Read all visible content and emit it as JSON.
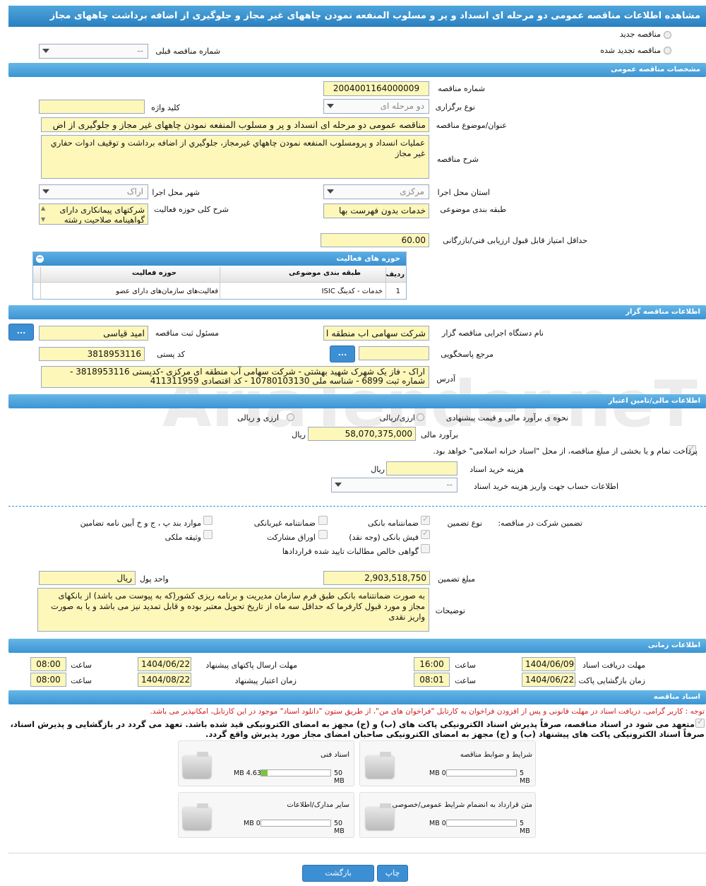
{
  "title": "مشاهده اطلاعات مناقصه عمومی دو مرحله ای انسداد و پر و مسلوب المنفعه نمودن چاههای غیر مجاز و جلوگیری از اضافه برداشت چاههای مجاز",
  "top": {
    "new_tender": "مناقصه جدید",
    "renewed_tender": "مناقصه تجدید شده",
    "prev_tender_label": "شماره مناقصه قبلی",
    "prev_tender_value": "--"
  },
  "general": {
    "header": "مشخصات مناقصه عمومی",
    "number_label": "شماره مناقصه",
    "number": "2004001164000009",
    "type_label": "نوع برگزاری",
    "type": "دو مرحله ای",
    "keyword_label": "کلید واژه",
    "keyword": "",
    "subject_label": "عنوان/موضوع مناقصه",
    "subject": "مناقصه عمومی دو مرحله ای انسداد و پر و مسلوب المنفعه نمودن چاههای غیر مجاز و جلوگیری از اض",
    "desc_label": "شرح مناقصه",
    "desc": "عمليات انسداد و پرومسلوب المنفعه نمودن چاههاي غيرمجاز، جلوگيري از اضافه برداشت و توقيف ادوات حفاري غير مجاز",
    "province_label": "استان محل اجرا",
    "province": "مرکزی",
    "city_label": "شهر محل اجرا",
    "city": "اراک",
    "category_label": "طبقه بندی موضوعی",
    "category": "خدمات بدون فهرست بها",
    "scope_label": "شرح کلی حوزه فعالیت",
    "scope": "شرکتهای پیمانکاری دارای گواهینامه صلاحیت رشته",
    "min_score_label": "حداقل امتیاز قابل قبول ارزیابی فنی/بازرگانی",
    "min_score": "60.00",
    "activities": {
      "title": "حوزه های فعالیت",
      "headers": [
        "ردیف",
        "طبقه بندی موضوعی",
        "حوزه فعالیت"
      ],
      "rows": [
        [
          "1",
          "خدمات - کدینگ ISIC",
          "فعالیت‌های سازمان‌های دارای عضو"
        ]
      ]
    }
  },
  "org": {
    "header": "اطلاعات مناقصه گزار",
    "agency_label": "نام دستگاه اجرایی مناقصه گزار",
    "agency": "شرکت سهامی اب منطقه ا",
    "officer_label": "مسئول ثبت مناقصه",
    "officer": "امید قیاسی",
    "ref_label": "مرجع پاسخگویی",
    "ref": "",
    "postal_label": "کد پستی",
    "postal": "3818953116",
    "address_label": "آدرس",
    "address": "اراک - فاز یک شهرک شهید بهشتی - شرکت سهامی آب منطقه ای مرکزی -کدپستی 3818953116 - شماره ثبت 6899 - شناسه ملی 10780103130 - کد اقتصادی 411311959",
    "btn": "..."
  },
  "finance": {
    "header": "اطلاعات مالی/تامین اعتبار",
    "method_label": "نحوه ی برآورد مالی و قیمت پیشنهادی",
    "opt1": "ارزی/ریالی",
    "opt2": "ارزی و ریالی",
    "estimate_label": "برآورد مالی",
    "estimate": "58,070,375,000",
    "rial": "ریال",
    "treasury": "پرداخت تمام و یا بخشی از مبلغ مناقصه، از محل \"اسناد خزانه اسلامی\" خواهد بود.",
    "doc_fee_label": "هزینه خرید اسناد",
    "doc_fee": "",
    "doc_fee_unit": "ریال",
    "account_label": "اطلاعات حساب جهت واریز هزینه خرید اسناد",
    "account": "--"
  },
  "guarantee": {
    "label": "تضمین شرکت در مناقصه:",
    "type_label": "نوع تضمین",
    "bank": "ضمانتنامه بانکی",
    "nonbank": "ضمانتنامه غیربانکی",
    "items_p": "موارد بند پ ، ج و خ آیین نامه تضامین",
    "check": "فیش بانکی (وجه نقد)",
    "bonds": "اوراق مشارکت",
    "property": "وثیقه ملکی",
    "claims": "گواهی خالص مطالبات تایید شده قراردادها",
    "amount_label": "مبلغ تضمین",
    "amount": "2,903,518,750",
    "currency_label": "واحد پول",
    "currency": "ریال",
    "notes_label": "توضیحات",
    "notes": "به صورت ضمانتنامه  بانکی  طبق فرم سازمان مدیریت و برنامه ریزی کشور(که به پیوست می باشد) از بانکهای مجاز و مورد قبول کارفرما که حداقل سه ماه از تاریخ تحویل معتبر بوده و قابل تمدید نیز می باشد و یا به صورت واریز نقدی"
  },
  "timing": {
    "header": "اطلاعات زمانی",
    "receive_label": "مهلت دریافت اسناد",
    "receive_date": "1404/06/09",
    "receive_time": "16:00",
    "send_label": "مهلت ارسال پاکتهای پیشنهاد",
    "send_date": "1404/06/22",
    "send_time": "08:00",
    "open_label": "زمان بازگشایی پاکت ها",
    "open_date": "1404/06/22",
    "open_time": "08:01",
    "validity_label": "زمان اعتبار پیشنهاد",
    "validity_date": "1404/08/22",
    "validity_time": "08:00",
    "time_label": "ساعت"
  },
  "docs": {
    "header": "اسناد مناقصه",
    "notice": "توجه : کاربر گرامی، دریافت اسناد در مهلت قانونی و پس از افزودن فراخوان به کارتابل \"فراخوان های من\"، از طریق ستون \"دانلود اسناد\" موجود در این کارتابل، امکانپذیر می باشد.",
    "pledge1": "متعهد می شود در اسناد مناقصه، صرفاً پذیرش اسناد الکترونیکی پاکت های (ب) و (ج) مجهز به امضای الکترونیکی قید شده باشد. تعهد می گردد در بازگشایی و پذیرش اسناد،",
    "pledge2": "صرفاً اسناد الکترونیکی پاکت های پیشنهاد (ب) و (ج) مجهز به امضای الکترونیکی صاحبان امضای مجاز مورد پذیرش واقع گردد.",
    "files": [
      {
        "name": "شرایط و ضوابط مناقصه",
        "used": "0 MB",
        "max": "5 MB",
        "fill": 0
      },
      {
        "name": "اسناد فنی",
        "used": "4.63 MB",
        "max": "50 MB",
        "fill": 0.09
      },
      {
        "name": "متن قرارداد به انضمام شرایط عمومی/خصوصی",
        "used": "0 MB",
        "max": "5 MB",
        "fill": 0
      },
      {
        "name": "سایر مدارک/اطلاعات",
        "used": "0 MB",
        "max": "50 MB",
        "fill": 0
      }
    ]
  },
  "buttons": {
    "print": "چاپ",
    "back": "بازگشت"
  }
}
